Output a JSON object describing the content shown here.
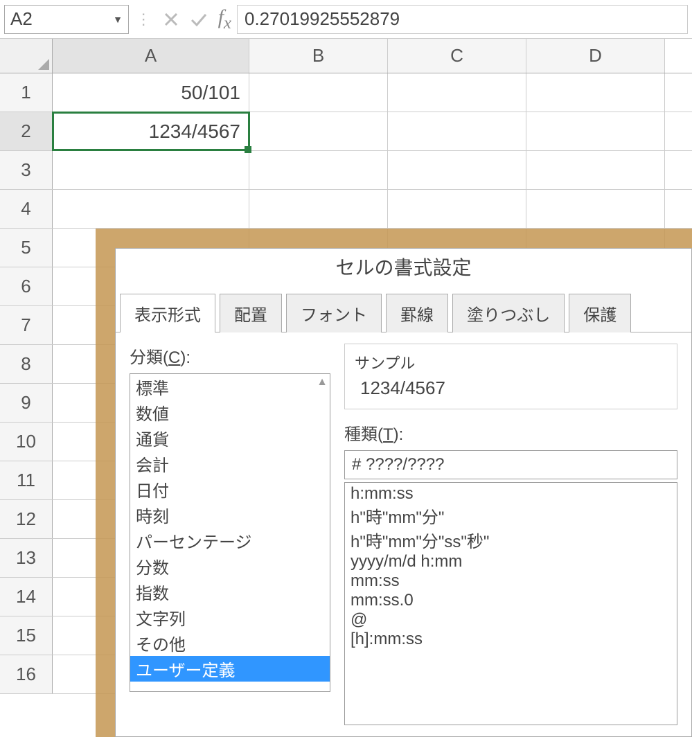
{
  "name_box": "A2",
  "formula_value": "0.27019925552879",
  "columns": [
    "A",
    "B",
    "C",
    "D"
  ],
  "rows": {
    "labels": [
      "1",
      "2",
      "3",
      "4",
      "5",
      "6",
      "7",
      "8",
      "9",
      "10",
      "11",
      "12",
      "13",
      "14",
      "15",
      "16"
    ],
    "a1": "50/101",
    "a2": "1234/4567"
  },
  "dialog": {
    "title": "セルの書式設定",
    "tabs": [
      "表示形式",
      "配置",
      "フォント",
      "罫線",
      "塗りつぶし",
      "保護"
    ],
    "category_label_prefix": "分類(",
    "category_label_key": "C",
    "category_label_suffix": "):",
    "categories": [
      "標準",
      "数値",
      "通貨",
      "会計",
      "日付",
      "時刻",
      "パーセンテージ",
      "分数",
      "指数",
      "文字列",
      "その他",
      "ユーザー定義"
    ],
    "sample_label": "サンプル",
    "sample_value": "1234/4567",
    "type_label_prefix": "種類(",
    "type_label_key": "T",
    "type_label_suffix": "):",
    "type_input": "# ????/????",
    "type_list": [
      "h:mm:ss",
      "h\"時\"mm\"分\"",
      "h\"時\"mm\"分\"ss\"秒\"",
      "yyyy/m/d h:mm",
      "mm:ss",
      "mm:ss.0",
      "@",
      "[h]:mm:ss"
    ]
  }
}
